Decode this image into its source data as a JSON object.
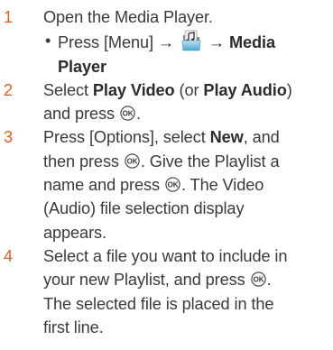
{
  "steps": [
    {
      "number": "1",
      "text": "Open the Media Player."
    },
    {
      "number": "2",
      "text_a": "Select ",
      "bold_a": "Play Video",
      "text_b": " (or ",
      "bold_b": "Play Audio",
      "text_c": ")",
      "text_d": "and press",
      "text_e": "."
    },
    {
      "number": "3",
      "text_a": "Press [Options], select ",
      "bold_a": "New",
      "text_b": ", and",
      "text_c": "then press",
      "text_d": ". Give the Playlist a",
      "text_e": "name and press",
      "text_f": ". The Video",
      "text_g": "(Audio) file selection display",
      "text_h": "appears."
    },
    {
      "number": "4",
      "text_a": "Select a file you want to include in",
      "text_b": "your new Playlist, and press",
      "text_c": ".",
      "text_d": "The selected file is placed in the",
      "text_e": "first line."
    }
  ],
  "substep": {
    "bullet": "•",
    "text_a": "Press [Menu]",
    "arrow_1": "→",
    "arrow_2": "→",
    "bold_a": "Media",
    "bold_b": "Player"
  },
  "icons": {
    "menu_icon": "media-folder-icon",
    "ok_key": "ok-key-icon"
  },
  "colors": {
    "step_number": "#e15f21",
    "text": "#3a3a3a"
  }
}
